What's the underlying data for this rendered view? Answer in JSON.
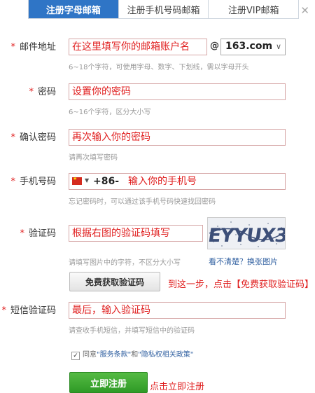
{
  "tabs": [
    {
      "label": "注册字母邮箱",
      "active": true
    },
    {
      "label": "注册手机号码邮箱",
      "active": false
    },
    {
      "label": "注册VIP邮箱",
      "active": false
    }
  ],
  "close_symbol": "✕",
  "required_mark": "*",
  "email": {
    "label": "邮件地址",
    "value": "在这里填写你的邮箱账户名",
    "at": "@",
    "domain": "163.com",
    "hint": "6~18个字符，可使用字母、数字、下划线，需以字母开头"
  },
  "password": {
    "label": "密码",
    "value": "设置你的密码",
    "hint": "6~16个字符，区分大小写"
  },
  "confirm": {
    "label": "确认密码",
    "value": "再次输入你的密码",
    "hint": "请再次填写密码"
  },
  "phone": {
    "label": "手机号码",
    "prefix": "+86-",
    "value": "输入你的手机号",
    "hint": "忘记密码时，可以通过该手机号码快速找回密码"
  },
  "captcha": {
    "label": "验证码",
    "value": "根据右图的验证码填写",
    "image_text": "EYYUX3",
    "hint": "请填写图片中的字符，不区分大小写",
    "refresh_link": "看不清楚？换张图片"
  },
  "get_code_button": "免费获取验证码",
  "annotation_step": "到这一步，点击【免费获取验证码】",
  "sms": {
    "label": "短信验证码",
    "value": "最后，输入验证码",
    "hint": "请查收手机短信，并填写短信中的验证码"
  },
  "agreement": {
    "checked": true,
    "text_before": "同意",
    "terms": "\"服务条款\"",
    "and": "和",
    "privacy": "\"隐私权相关政策\""
  },
  "register_button": "立即注册",
  "annotation_register": "点击立即注册",
  "colors": {
    "tab_active": "#2f75c6",
    "annotation_red": "#e02020",
    "register_green": "#3aa52f",
    "link_blue": "#2f5fa0"
  },
  "icons": {
    "close": "close-icon",
    "dropdown": "chevron-down-icon",
    "flag": "china-flag-icon",
    "checkbox": "checkbox-checked-icon"
  }
}
